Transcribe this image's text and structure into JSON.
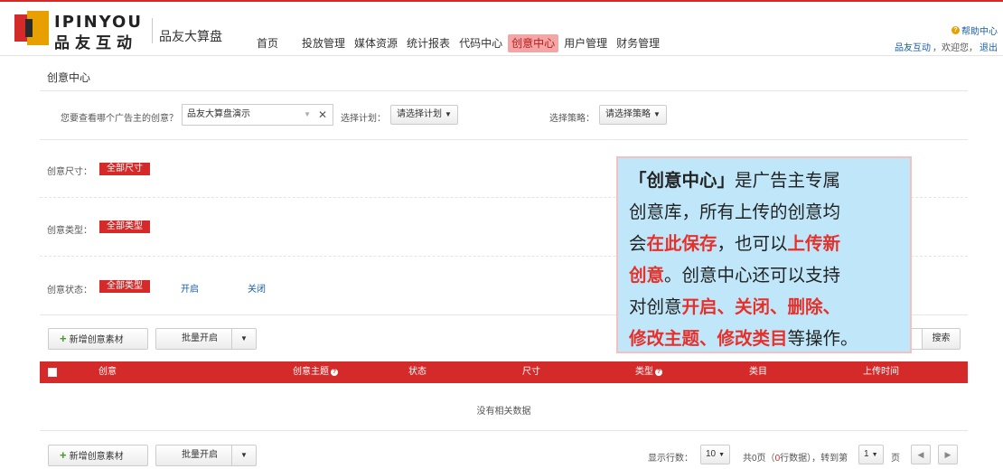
{
  "header": {
    "logo_en": "IPINYOU",
    "logo_cn": "品友互动",
    "app_name": "品友大算盘",
    "nav": [
      {
        "label": "首页",
        "active": false
      },
      {
        "label": "投放管理",
        "active": false
      },
      {
        "label": "媒体资源",
        "active": false
      },
      {
        "label": "统计报表",
        "active": false
      },
      {
        "label": "代码中心",
        "active": false
      },
      {
        "label": "创意中心",
        "active": true
      },
      {
        "label": "用户管理",
        "active": false
      },
      {
        "label": "财务管理",
        "active": false
      }
    ],
    "help_label": "帮助中心",
    "user_name": "品友互动",
    "welcome": "，欢迎您，",
    "logout": "退出"
  },
  "page_title": "创意中心",
  "filters": {
    "advertiser_label": "您要查看哪个广告主的创意？",
    "advertiser_value": "品友大算盘演示",
    "plan_label": "选择计划：",
    "plan_button": "请选择计划",
    "strategy_label": "选择策略：",
    "strategy_button": "请选择策略",
    "size_label": "创意尺寸：",
    "size_chip": "全部尺寸",
    "type_label": "创意类型：",
    "type_chip": "全部类型",
    "status_label": "创意状态：",
    "status_chip": "全部类型",
    "status_on": "开启",
    "status_off": "关闭"
  },
  "actions": {
    "add_label": "新增创意素材",
    "batch_open_label": "批量开启",
    "search_label": "搜索"
  },
  "table": {
    "columns": [
      "创意",
      "创意主题",
      "状态",
      "尺寸",
      "类型",
      "类目",
      "上传时间"
    ],
    "empty_text": "没有相关数据"
  },
  "pager": {
    "rows_label": "显示行数：",
    "rows_value": "10",
    "summary_pre": "共0页（",
    "summary_count": "0",
    "summary_post": "行数据），转到第",
    "page_value": "1",
    "page_suffix": "页",
    "prev": "◀",
    "next": "▶"
  },
  "callout": {
    "l1_bold": "「创意中心」",
    "l1_rest": "是广告主专属",
    "l2": "创意库，所有上传的创意均",
    "l3_a": "会",
    "l3_red": "在此保存",
    "l3_b": "，也可以",
    "l3_red2": "上传新",
    "l4_red": "创意",
    "l4_rest": "。创意中心还可以支持",
    "l5_a": "对创意",
    "l5_red": "开启、关闭、删除、",
    "l6_red": "修改主题、修改类目",
    "l6_rest": "等操作。"
  },
  "colors": {
    "brand_red": "#d42a2a",
    "link_blue": "#1a5fa8",
    "callout_bg": "#bfe7f9",
    "callout_red": "#e8302a"
  }
}
